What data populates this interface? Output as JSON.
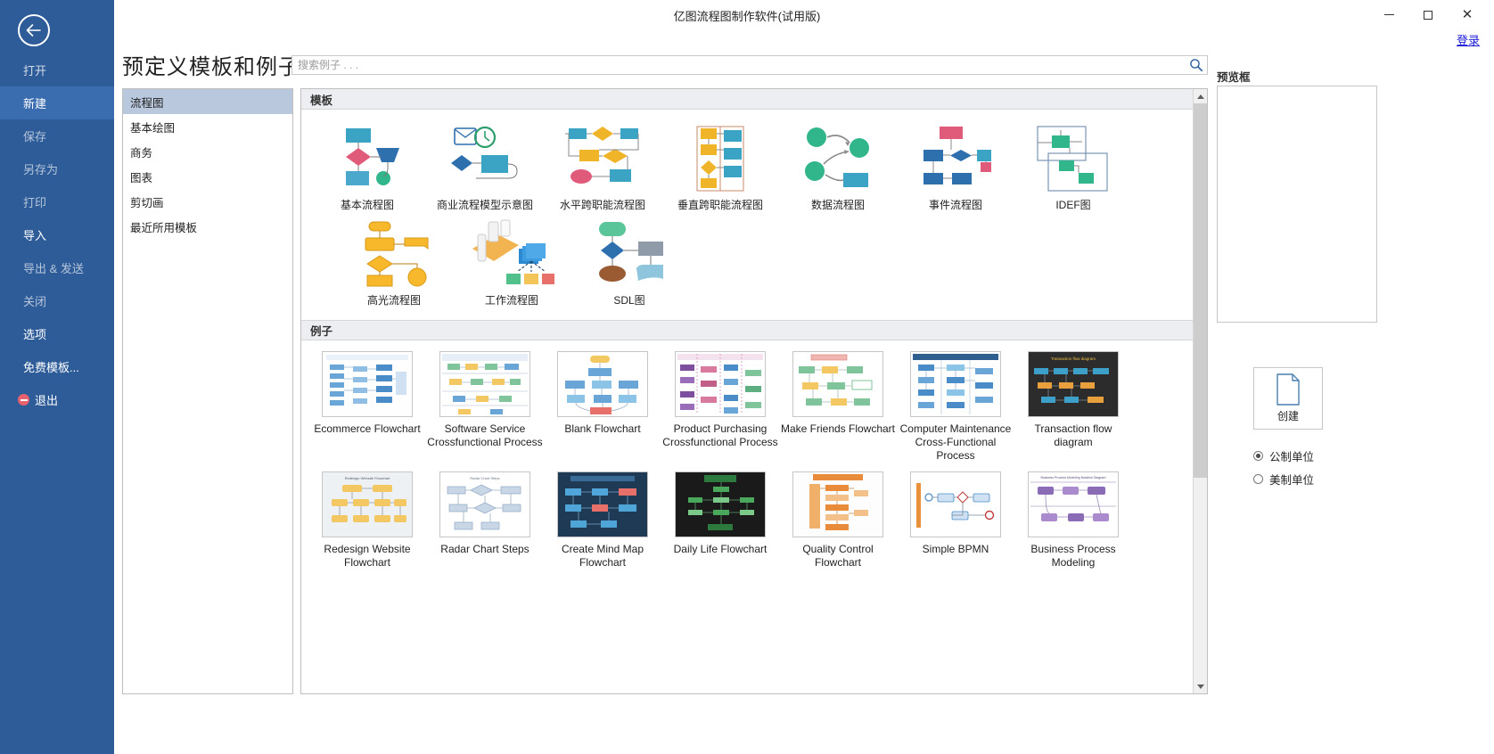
{
  "window": {
    "title": "亿图流程图制作软件(试用版)",
    "minimize": "–",
    "maximize": "□",
    "close": "✕"
  },
  "login": {
    "label": "登录"
  },
  "sidebar": {
    "back_icon": "back-arrow-icon",
    "items": [
      {
        "label": "打开",
        "state": "normal"
      },
      {
        "label": "新建",
        "state": "active"
      },
      {
        "label": "保存",
        "state": "dim"
      },
      {
        "label": "另存为",
        "state": "dim"
      },
      {
        "label": "打印",
        "state": "dim"
      },
      {
        "label": "导入",
        "state": "bright"
      },
      {
        "label": "导出 & 发送",
        "state": "dim"
      },
      {
        "label": "关闭",
        "state": "dim"
      },
      {
        "label": "选项",
        "state": "bright"
      },
      {
        "label": "免费模板...",
        "state": "bright"
      },
      {
        "label": "退出",
        "state": "bright",
        "icon": "exit-icon"
      }
    ]
  },
  "header": {
    "page_title": "预定义模板和例子"
  },
  "search": {
    "placeholder": "搜索例子 . . .",
    "value": "",
    "icon": "search-icon"
  },
  "categories": {
    "items": [
      {
        "label": "流程图",
        "selected": true
      },
      {
        "label": "基本绘图",
        "selected": false
      },
      {
        "label": "商务",
        "selected": false
      },
      {
        "label": "图表",
        "selected": false
      },
      {
        "label": "剪切画",
        "selected": false
      },
      {
        "label": "最近所用模板",
        "selected": false
      }
    ]
  },
  "templates_section": {
    "heading": "模板",
    "items": [
      {
        "label": "基本流程图",
        "thumb": "basic-flowchart-thumb"
      },
      {
        "label": "商业流程模型示意图",
        "thumb": "business-process-model-thumb"
      },
      {
        "label": "水平跨职能流程图",
        "thumb": "horizontal-crossfunctional-thumb"
      },
      {
        "label": "垂直跨职能流程图",
        "thumb": "vertical-crossfunctional-thumb"
      },
      {
        "label": "数据流程图",
        "thumb": "data-flow-thumb"
      },
      {
        "label": "事件流程图",
        "thumb": "event-flow-thumb"
      },
      {
        "label": "IDEF图",
        "thumb": "idef-thumb"
      },
      {
        "label": "高光流程图",
        "thumb": "highlight-flowchart-thumb"
      },
      {
        "label": "工作流程图",
        "thumb": "workflow-thumb"
      },
      {
        "label": "SDL图",
        "thumb": "sdl-thumb"
      }
    ]
  },
  "examples_section": {
    "heading": "例子",
    "items": [
      {
        "label": "Ecommerce Flowchart",
        "thumb": "ecommerce-flowchart-thumb"
      },
      {
        "label": "Software Service Crossfunctional Process",
        "thumb": "software-service-thumb"
      },
      {
        "label": "Blank Flowchart",
        "thumb": "blank-flowchart-thumb"
      },
      {
        "label": "Product Purchasing Crossfunctional Process",
        "thumb": "product-purchasing-thumb"
      },
      {
        "label": "Make Friends Flowchart",
        "thumb": "make-friends-thumb"
      },
      {
        "label": "Computer Maintenance Cross-Functional Process",
        "thumb": "computer-maintenance-thumb"
      },
      {
        "label": "Transaction flow diagram",
        "thumb": "transaction-flow-thumb"
      },
      {
        "label": "Redesign Website Flowchart",
        "thumb": "redesign-website-thumb"
      },
      {
        "label": "Radar Chart Steps",
        "thumb": "radar-chart-steps-thumb"
      },
      {
        "label": "Create Mind Map Flowchart",
        "thumb": "create-mind-map-thumb"
      },
      {
        "label": "Daily Life Flowchart",
        "thumb": "daily-life-thumb"
      },
      {
        "label": "Quality Control Flowchart",
        "thumb": "quality-control-thumb"
      },
      {
        "label": "Simple BPMN",
        "thumb": "simple-bpmn-thumb"
      },
      {
        "label": "Business Process Modeling",
        "thumb": "business-process-modeling-thumb"
      }
    ]
  },
  "right_panel": {
    "preview_title": "预览框",
    "create_button": {
      "label": "创建",
      "icon": "new-document-icon"
    },
    "units": [
      {
        "label": "公制单位",
        "selected": true
      },
      {
        "label": "美制单位",
        "selected": false
      }
    ]
  },
  "colors": {
    "sidebar_blue": "#2e5c99",
    "sidebar_active": "#3a6cb0",
    "category_selected": "#bac8de",
    "section_header": "#eceef1",
    "link_blue": "#1a1ad6"
  }
}
